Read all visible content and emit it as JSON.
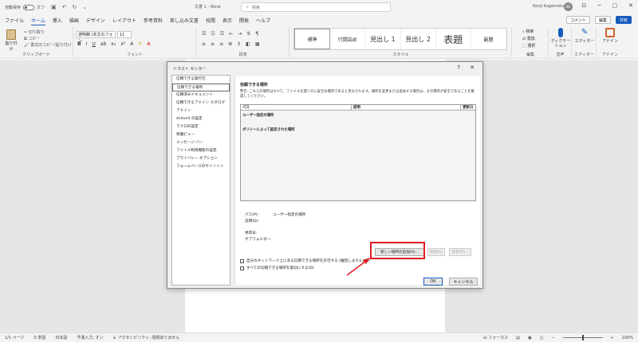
{
  "titlebar": {
    "autosave_label": "自動保存",
    "autosave_state": "オフ",
    "doc_title": "文書 1 - Word",
    "search_placeholder": "検索",
    "user_name": "Kenji Kagemoto",
    "avatar_initials": "KK"
  },
  "menu": {
    "tabs": [
      "ファイル",
      "ホーム",
      "挿入",
      "描画",
      "デザイン",
      "レイアウト",
      "参考資料",
      "差し込み文書",
      "校閲",
      "表示",
      "開発",
      "ヘルプ"
    ],
    "active_tab": "ホーム",
    "comment_label": "コメント",
    "edit_label": "編集",
    "share_label": "共有"
  },
  "ribbon": {
    "clipboard": {
      "paste": "貼り付け",
      "cut": "切り取り",
      "copy": "コピー",
      "format_painter": "書式のコピー/貼り付け",
      "group": "クリップボード"
    },
    "font": {
      "font_name": "游明朝 (本文のフォン",
      "font_size": "11",
      "group": "フォント"
    },
    "paragraph": {
      "group": "段落"
    },
    "styles": {
      "items": [
        "標準",
        "行間詰め",
        "見出し 1",
        "見出し 2",
        "表題",
        "副題"
      ],
      "group": "スタイル"
    },
    "editing": {
      "find": "検索",
      "replace": "置換",
      "select": "選択",
      "group": "編集"
    },
    "voice": {
      "dictate": "ディクテーション",
      "group": "音声"
    },
    "editor": {
      "label": "エディター",
      "group": "エディター"
    },
    "addins": {
      "label": "アドイン",
      "group": "アドイン"
    }
  },
  "dialog": {
    "title": "トラスト センター",
    "help": "?",
    "close": "✕",
    "nav": [
      "信頼できる発行元",
      "信頼できる場所",
      "信頼済みドキュメント",
      "信頼できるアドイン カタログ",
      "アドイン",
      "ActiveX の設定",
      "マクロの設定",
      "保護ビュー",
      "メッセージ バー",
      "ファイル制限機能の設定",
      "プライバシー オプション",
      "フォームベースのサインイン"
    ],
    "selected_nav": "信頼できる場所",
    "section_title": "信頼できる場所",
    "warning": "警告: これらの場所はすべて、ファイルを開くのに安全な場所であると見なされます。場所を変更または追加する場合は、その場所が安全であることを確認してください。",
    "columns": [
      "パス",
      "説明",
      "更新日"
    ],
    "group_user": "ユーザー指定の場所",
    "group_policy": "ポリシーによって設定された場所",
    "path_label": "パス(P):",
    "path_value": "ユーザー指定の場所",
    "description_label": "説明(D):",
    "modified_label": "更新日:",
    "subfolders_label": "サブフォルダー:",
    "add_button": "新しい場所の追加(A)...",
    "remove_button": "削除(R)",
    "modify_button": "変更(M)...",
    "network_checkbox": "自分のネットワーク上にある信頼できる場所を許可する (推奨しません)(W)",
    "disable_checkbox": "すべての信頼できる場所を無効にする(D)",
    "ok": "OK",
    "cancel": "キャンセル"
  },
  "statusbar": {
    "page": "1/1 ページ",
    "words": "0 単語",
    "language": "日本語",
    "predict": "予測入力: オン",
    "accessibility": "アクセシビリティ: 問題ありません",
    "focus": "フォーカス",
    "zoom": "100%"
  },
  "colors": {
    "accent": "#185abd",
    "highlight_frame": "#e01c24",
    "arrow": "#e01c24"
  }
}
